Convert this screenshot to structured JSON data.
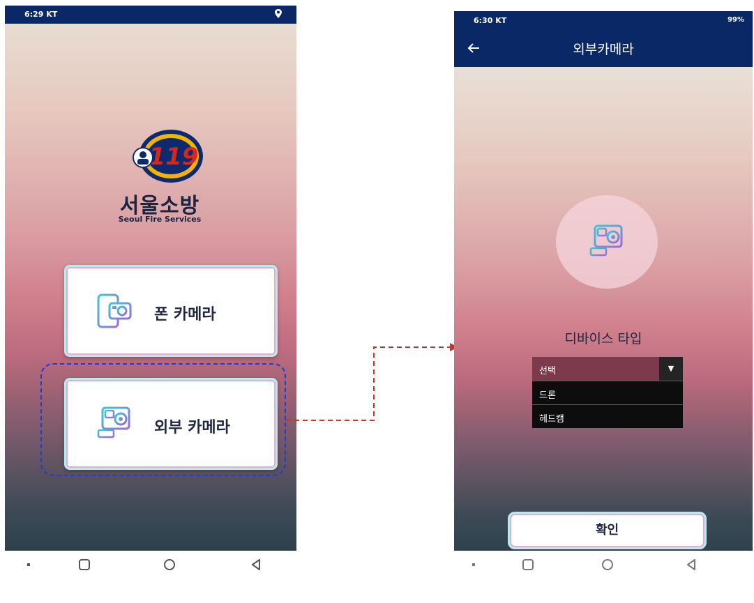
{
  "left_screen": {
    "status_time": "6:29 KT",
    "brand_badge": "119",
    "brand_title": "서울소방",
    "brand_subtitle": "Seoul Fire Services",
    "menu": [
      {
        "label": "폰 카메라",
        "icon": "phone-camera-icon"
      },
      {
        "label": "외부 카메라",
        "icon": "action-camera-icon"
      }
    ]
  },
  "right_screen": {
    "status_time": "6:30 KT",
    "status_battery": "99%",
    "title": "외부카메라",
    "device_type_label": "디바이스 타입",
    "dropdown": {
      "selected": "선택",
      "options": [
        "드론",
        "헤드캠"
      ]
    },
    "confirm_label": "확인"
  },
  "colors": {
    "header": "#0a2866",
    "highlight_border": "#1f3cd6",
    "connector_arrow": "#c0392b",
    "dropdown_selected": "#7d3a4c"
  }
}
